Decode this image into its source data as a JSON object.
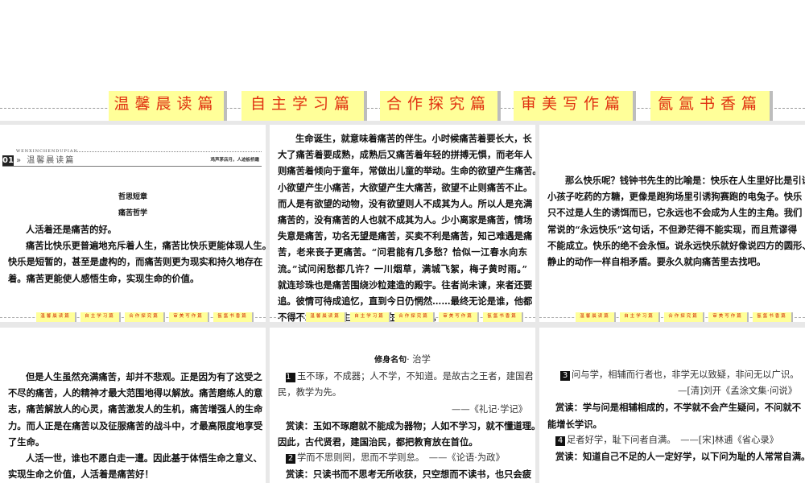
{
  "main_tabs": [
    "温馨晨读篇",
    "自主学习篇",
    "合作探究篇",
    "审美写作篇",
    "氤氲书香篇"
  ],
  "mini_tabs": [
    "温馨晨读篇",
    "自主学习篇",
    "合作探究篇",
    "审美写作篇",
    "氤氲书香篇"
  ],
  "header": {
    "number": "01",
    "pinyin": "WENXINCHENDUPIAN",
    "section": "» 温馨晨读篇",
    "motto": "鸡声茅店月，人迹板桥霜"
  },
  "panel1": {
    "category": "哲思短章",
    "title": "痛苦哲学",
    "lines": [
      "人活着还是痛苦的好。",
      "痛苦比快乐更普遍地充斥着人生，痛苦比快乐更能体现人生。",
      "快乐是短暂的，甚至是虚构的，而痛苦则更为现实和持久地存在",
      "着。痛苦更能使人感悟生命，实现生命的价值。"
    ]
  },
  "panel2": {
    "lines": [
      "生命诞生，就意味着痛苦的伴生。小时候痛苦着要长大，长",
      "大了痛苦着要成熟，成熟后又痛苦着年轻的拼搏无惧，而老年人",
      "则痛苦着倾向于童年，常做出儿童的举动。生命的欲望产生痛苦。",
      "小欲望产生小痛苦，大欲望产生大痛苦，欲望不止则痛苦不止。",
      "而人是有欲望的动物，没有欲望则人不成其为人。所以人是充满",
      "痛苦的，没有痛苦的人也就不成其为人。少小离家是痛苦，情场",
      "失意是痛苦，功名无望是痛苦，买卖不利是痛苦，知己难遇是痛",
      "苦，老来丧子更痛苦。“问君能有几多愁？恰似一江春水向东",
      "流。”试问闲愁都几许？一川烟草，满城飞絮，梅子黄时雨。”",
      "就连珍珠也是痛苦围绕沙粒建造的殿宇。往者尚未谏，来者还要",
      "追。彼情可待成追忆，直到今日仍惘然……最终无论是谁，他都",
      "不得不承认，人生的所有存在都是痛苦。"
    ]
  },
  "panel3": {
    "lines": [
      "那么快乐呢？钱钟书先生的比喻是：快乐在人生里好比是引诱",
      "小孩子吃药的方糖，更像是跑狗场里引诱狗赛跑的电兔子。快乐",
      "只不过是人生的诱饵而已，它永远也不会成为人生的主角。我们",
      "常说的“永远快乐”这句话，不但渺茫得不能实现，而且荒谬得",
      "不能成立。快乐的绝不会永恒。说永远快乐就好像说四方的圆形、",
      "静止的动作一样自相矛盾。要永久就向痛苦里去找吧。"
    ]
  },
  "panel4": {
    "lines": [
      "但是人生虽然充满痛苦，却并不悲观。正是因为有了这受之",
      "不尽的痛苦，人的精神才最大范围地得以解放。痛苦磨练人的意",
      "志，痛苦解放人的心灵，痛苦激发人的生机，痛苦增强人的生命",
      "力。而人正是在痛苦以及征服痛苦的战斗中，才最高限度地享受",
      "了生命。",
      "人活一世，谁也不愿白走一遭。因此基于体悟生命之意义、",
      "实现生命之价值，人活着是痛苦好！"
    ]
  },
  "panel5": {
    "title": "修身名句",
    "subtitle": "· 治学",
    "q1_num": "1",
    "q1_a": "玉不琢，不成器；人不学，不知道。是故古之王者，建国君",
    "q1_b": "民，教学为先。",
    "q1_src": "——《礼记·学记》",
    "r1_a": "赏读：玉如不琢磨就不能成为器物；人如不学习，就不懂道理。",
    "r1_b": "因此，古代贤君，建国治民，都把教育放在首位。",
    "q2_num": "2",
    "q2": "学而不思则罔，思而不学则怠。　——《论语·为政》",
    "r2": "赏读：只读书而不思考无所收获，只空想而不读书，也只会疲"
  },
  "panel6": {
    "q3_num": "3",
    "q3": "问与学，相辅而行者也，非学无以致疑，非问无以广识。",
    "q3_src": "—[清]刘开《孟涂文集·问说》",
    "r3_a": "赏读：学与问是相辅相成的，不学就不会产生疑问，不问就不",
    "r3_b": "能增长学识。",
    "q4_num": "4",
    "q4": "足者好学，耻下问者自满。　——[宋]林逋《省心录》",
    "r4": "赏读：知道自己不足的人一定好学，以下问为耻的人常常自满。"
  }
}
